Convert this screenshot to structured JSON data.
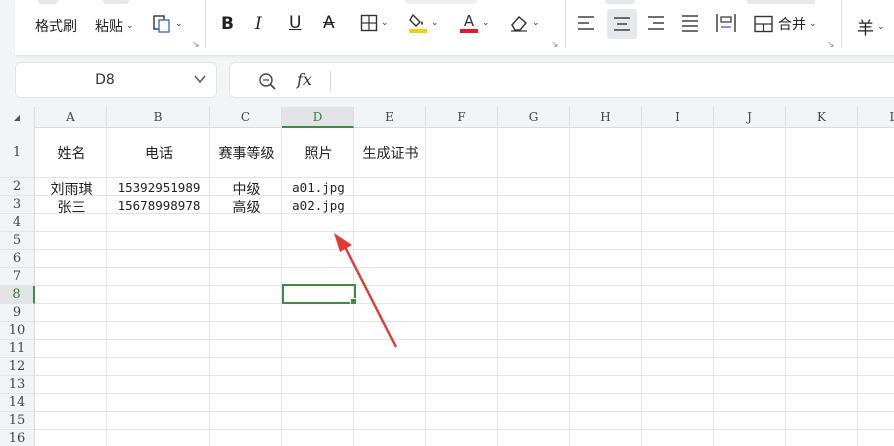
{
  "ribbon": {
    "format_painter": "格式刷",
    "paste": "粘贴",
    "merge": "合并",
    "currency": "羊"
  },
  "formula_bar": {
    "cell_ref": "D8",
    "fx": "fx",
    "formula": ""
  },
  "columns": [
    "A",
    "B",
    "C",
    "D",
    "E",
    "F",
    "G",
    "H",
    "I",
    "J",
    "K",
    "L"
  ],
  "rows": [
    "1",
    "2",
    "3",
    "4",
    "5",
    "6",
    "7",
    "8",
    "9",
    "10",
    "11",
    "12",
    "13",
    "14",
    "15",
    "16"
  ],
  "selected_cell": "D8",
  "sheet": {
    "headers": [
      "姓名",
      "电话",
      "赛事等级",
      "照片",
      "生成证书"
    ],
    "data": [
      [
        "刘雨琪",
        "15392951989",
        "中级",
        "a01.jpg"
      ],
      [
        "张三",
        "15678998978",
        "高级",
        "a02.jpg"
      ]
    ]
  },
  "colors": {
    "accent_green": "#3d8c40",
    "annotation_arrow": "#e53935",
    "font_color_underline": "#e02020",
    "highlight_underline": "#f5d100"
  }
}
